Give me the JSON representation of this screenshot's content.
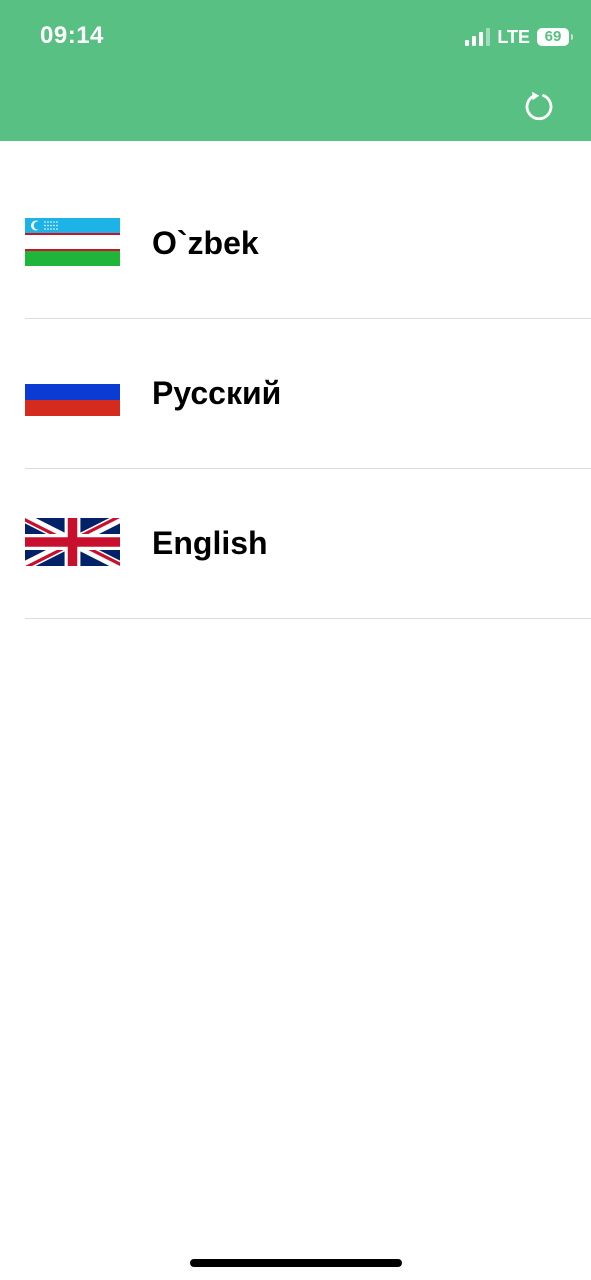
{
  "status_bar": {
    "time": "09:14",
    "network": "LTE",
    "battery": "69"
  },
  "header": {
    "background_color": "#58c082",
    "refresh_icon": "refresh-icon"
  },
  "languages": [
    {
      "label": "O`zbek",
      "flag": "uzbekistan-flag-icon"
    },
    {
      "label": "Русский",
      "flag": "russia-flag-icon"
    },
    {
      "label": "English",
      "flag": "uk-flag-icon"
    }
  ]
}
